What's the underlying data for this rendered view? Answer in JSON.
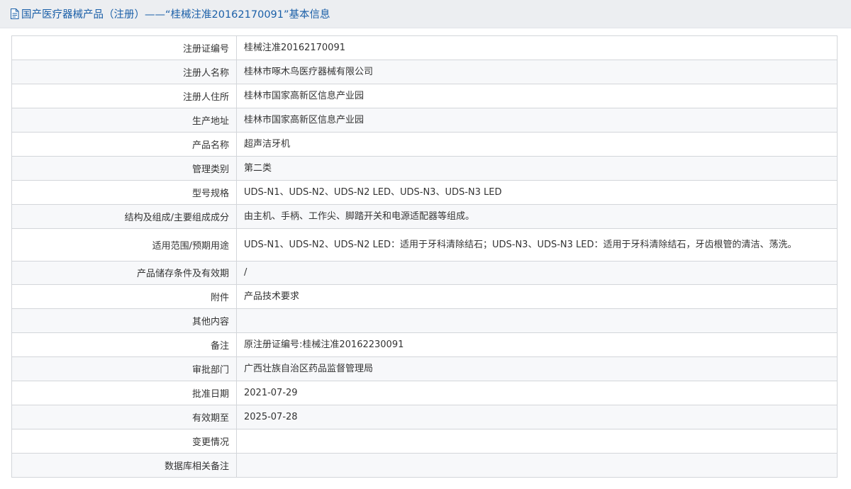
{
  "header": {
    "title": "国产医疗器械产品（注册）——“桂械注准20162170091”基本信息"
  },
  "rows": [
    {
      "label": "注册证编号",
      "value": "桂械注准20162170091"
    },
    {
      "label": "注册人名称",
      "value": "桂林市啄木鸟医疗器械有限公司"
    },
    {
      "label": "注册人住所",
      "value": "桂林市国家高新区信息产业园"
    },
    {
      "label": "生产地址",
      "value": "桂林市国家高新区信息产业园"
    },
    {
      "label": "产品名称",
      "value": "超声洁牙机"
    },
    {
      "label": "管理类别",
      "value": "第二类"
    },
    {
      "label": "型号规格",
      "value": "UDS-N1、UDS-N2、UDS-N2 LED、UDS-N3、UDS-N3 LED"
    },
    {
      "label": "结构及组成/主要组成成分",
      "value": "由主机、手柄、工作尖、脚踏开关和电源适配器等组成。"
    },
    {
      "label": "适用范围/预期用途",
      "value": "UDS-N1、UDS-N2、UDS-N2 LED：适用于牙科清除结石；UDS-N3、UDS-N3 LED：适用于牙科清除结石，牙齿根管的清洁、荡洗。"
    },
    {
      "label": "产品储存条件及有效期",
      "value": "/"
    },
    {
      "label": "附件",
      "value": "产品技术要求"
    },
    {
      "label": "其他内容",
      "value": ""
    },
    {
      "label": "备注",
      "value": "原注册证编号:桂械注准20162230091"
    },
    {
      "label": "审批部门",
      "value": "广西壮族自治区药品监督管理局"
    },
    {
      "label": "批准日期",
      "value": "2021-07-29"
    },
    {
      "label": "有效期至",
      "value": "2025-07-28"
    },
    {
      "label": "变更情况",
      "value": ""
    },
    {
      "label": "数据库相关备注",
      "value": ""
    }
  ]
}
